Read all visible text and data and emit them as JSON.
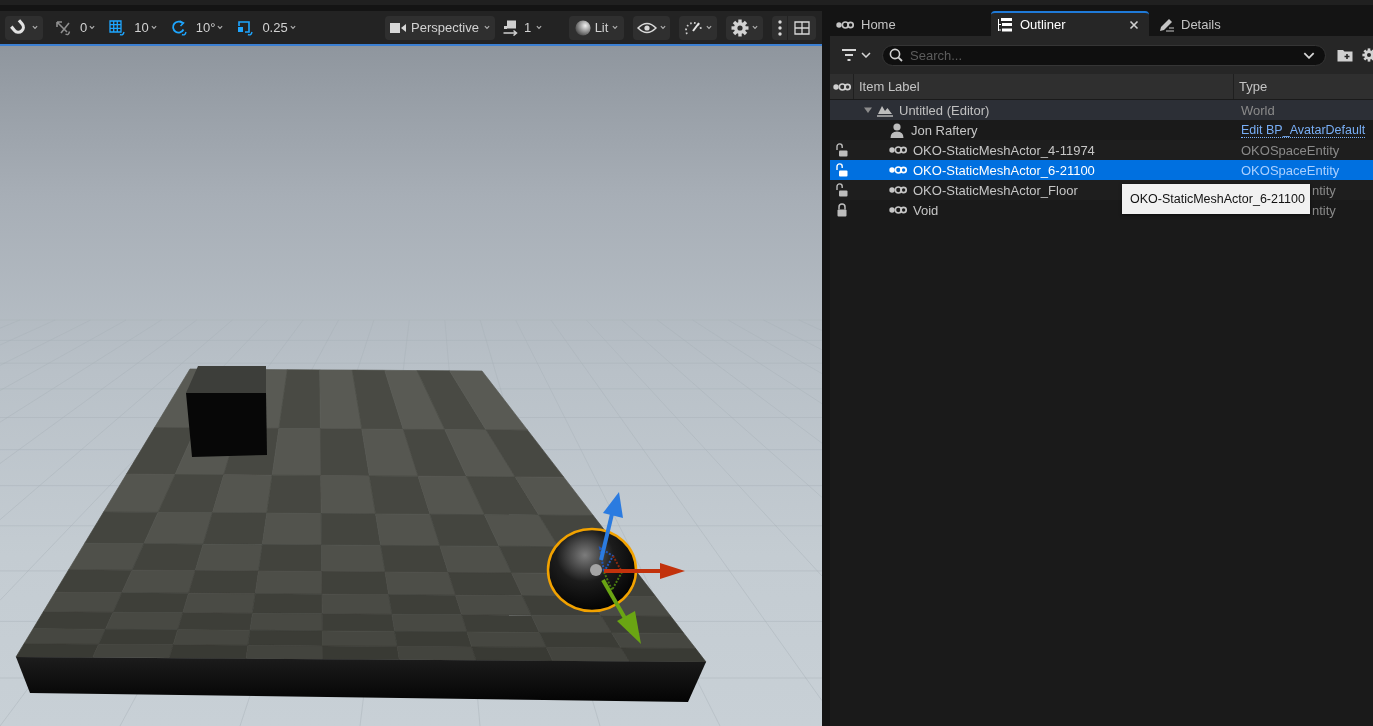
{
  "viewport_toolbar": {
    "snap_tools": [
      {
        "value": "0",
        "on": false
      },
      {
        "value": "10",
        "on": true
      },
      {
        "value": "10°",
        "on": true
      },
      {
        "value": "0.25",
        "on": true
      }
    ],
    "projection": "Perspective",
    "camera_speed": "1",
    "view_mode": "Lit"
  },
  "outliner": {
    "tabs": [
      {
        "label": "Home",
        "selected": false
      },
      {
        "label": "Outliner",
        "selected": true
      },
      {
        "label": "Details",
        "selected": false
      }
    ],
    "search": {
      "placeholder": "Search..."
    },
    "columns": [
      "Item Label",
      "Type"
    ],
    "tree": [
      {
        "label": "Untitled (Editor)",
        "type": "World",
        "kind": "world",
        "expanded": true,
        "selected": false,
        "children": [
          {
            "label": "Jon Raftery",
            "type": "Edit BP_AvatarDefault",
            "kind": "avatar",
            "selected": false,
            "under_tooltip": false
          },
          {
            "label": "OKO-StaticMeshActor_4-11974",
            "type": "OKOSpaceEntity",
            "kind": "actor",
            "locked": false,
            "selected": false,
            "under_tooltip": false
          },
          {
            "label": "OKO-StaticMeshActor_6-21100",
            "type": "OKOSpaceEntity",
            "kind": "actor",
            "locked": false,
            "selected": true,
            "under_tooltip": false
          },
          {
            "label": "OKO-StaticMeshActor_Floor",
            "type": "ntity",
            "kind": "actor",
            "locked": false,
            "selected": false,
            "under_tooltip": true
          },
          {
            "label": "Void",
            "type": "ntity",
            "kind": "actor",
            "locked": true,
            "selected": false,
            "under_tooltip": true
          }
        ]
      }
    ],
    "tooltip": {
      "text": "OKO-StaticMeshActor_6-21100"
    }
  }
}
